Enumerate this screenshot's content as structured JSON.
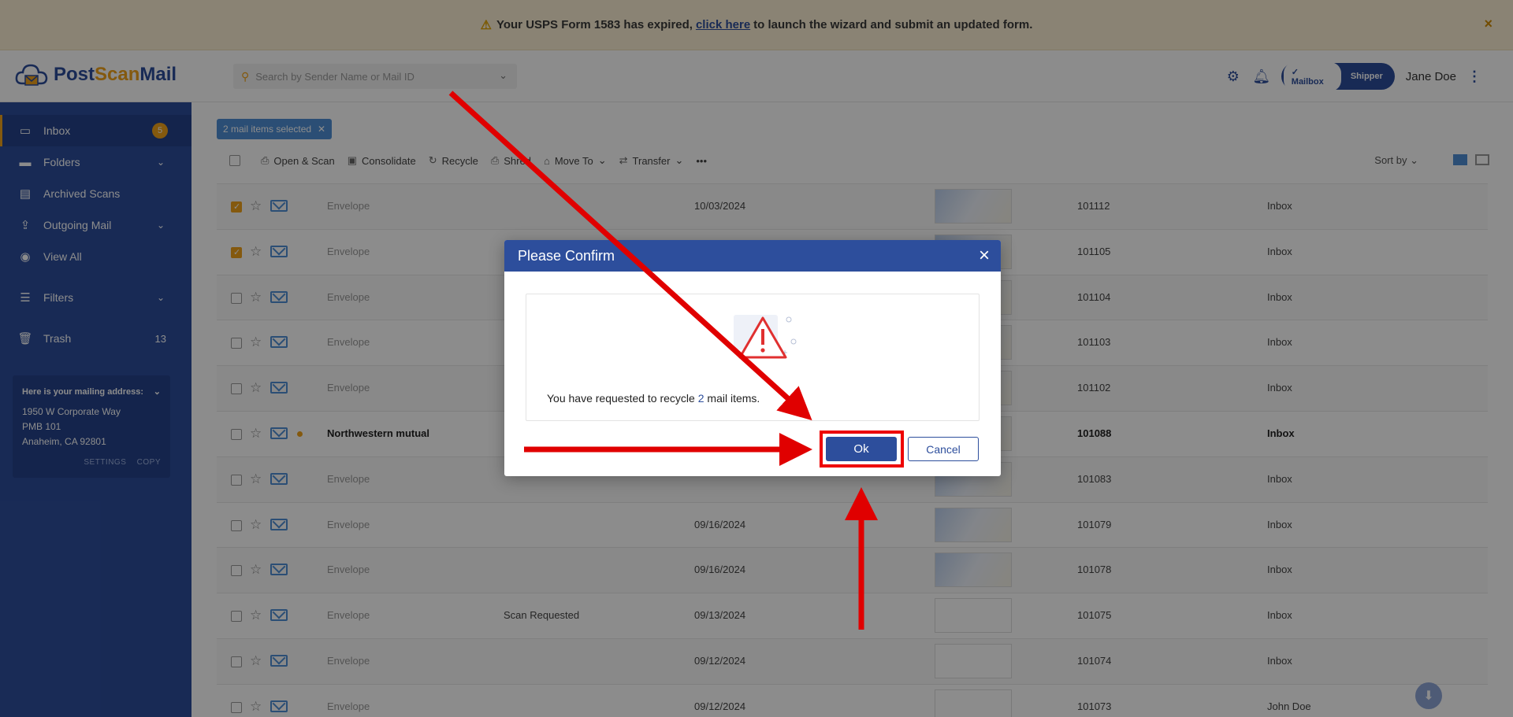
{
  "banner": {
    "text_before": "Your USPS Form 1583 has expired,",
    "link": "click here",
    "text_after": "to launch the wizard and submit an updated form.",
    "close": "×"
  },
  "brand": {
    "part1": "Post",
    "part2": "Scan",
    "part3": "Mail"
  },
  "search": {
    "placeholder": "Search by Sender Name or Mail ID"
  },
  "header": {
    "toggle_active": "✓ Mailbox",
    "toggle_other": "Shipper",
    "user": "Jane Doe"
  },
  "sidebar": {
    "items": [
      {
        "label": "Inbox",
        "badge": "5"
      },
      {
        "label": "Folders"
      },
      {
        "label": "Archived Scans"
      },
      {
        "label": "Outgoing Mail"
      },
      {
        "label": "View All"
      },
      {
        "label": "Filters"
      },
      {
        "label": "Trash",
        "count": "13"
      }
    ],
    "address": {
      "heading": "Here is your mailing address:",
      "line1": "1950 W Corporate Way",
      "line2": "PMB 101",
      "line3": "Anaheim, CA 92801",
      "settings": "SETTINGS",
      "copy": "COPY"
    }
  },
  "main": {
    "selection": "2 mail items selected",
    "toolbar": {
      "open_scan": "Open & Scan",
      "consolidate": "Consolidate",
      "recycle": "Recycle",
      "shred": "Shred",
      "move_to": "Move To",
      "transfer": "Transfer",
      "more": "•••",
      "sort_by": "Sort by"
    },
    "rows": [
      {
        "sender": "Envelope",
        "status": "",
        "date": "10/03/2024",
        "id": "101112",
        "loc": "Inbox",
        "checked": true
      },
      {
        "sender": "Envelope",
        "status": "",
        "date": "",
        "id": "101105",
        "loc": "Inbox",
        "checked": true
      },
      {
        "sender": "Envelope",
        "status": "",
        "date": "",
        "id": "101104",
        "loc": "Inbox",
        "checked": false
      },
      {
        "sender": "Envelope",
        "status": "",
        "date": "",
        "id": "101103",
        "loc": "Inbox",
        "checked": false
      },
      {
        "sender": "Envelope",
        "status": "",
        "date": "",
        "id": "101102",
        "loc": "Inbox",
        "checked": false
      },
      {
        "sender": "Northwestern mutual",
        "status": "",
        "date": "",
        "id": "101088",
        "loc": "Inbox",
        "checked": false,
        "unread": true
      },
      {
        "sender": "Envelope",
        "status": "",
        "date": "",
        "id": "101083",
        "loc": "Inbox",
        "checked": false
      },
      {
        "sender": "Envelope",
        "status": "",
        "date": "09/16/2024",
        "id": "101079",
        "loc": "Inbox",
        "checked": false
      },
      {
        "sender": "Envelope",
        "status": "",
        "date": "09/16/2024",
        "id": "101078",
        "loc": "Inbox",
        "checked": false
      },
      {
        "sender": "Envelope",
        "status": "Scan Requested",
        "date": "09/13/2024",
        "id": "101075",
        "loc": "Inbox",
        "checked": false
      },
      {
        "sender": "Envelope",
        "status": "",
        "date": "09/12/2024",
        "id": "101074",
        "loc": "Inbox",
        "checked": false
      },
      {
        "sender": "Envelope",
        "status": "",
        "date": "09/12/2024",
        "id": "101073",
        "loc": "John Doe",
        "checked": false
      }
    ]
  },
  "modal": {
    "title": "Please Confirm",
    "close": "×",
    "msg_before": "You have requested to recycle",
    "msg_count": "2",
    "msg_after": "mail items.",
    "ok": "Ok",
    "cancel": "Cancel"
  },
  "colors": {
    "brand_blue": "#2d4e9c",
    "accent_orange": "#f0a21b",
    "annotation_red": "#e00000"
  }
}
